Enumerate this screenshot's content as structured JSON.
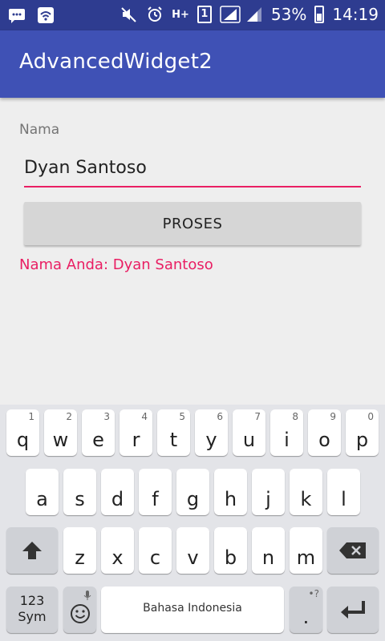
{
  "status_bar": {
    "battery_percent": "53%",
    "time": "14:19",
    "network_label": "H+",
    "sim_label": "1"
  },
  "app_bar": {
    "title": "AdvancedWidget2"
  },
  "form": {
    "label": "Nama",
    "input_value": "Dyan Santoso",
    "button_label": "PROSES",
    "result_text": "Nama Anda: Dyan Santoso"
  },
  "colors": {
    "status_bar": "#2e3c90",
    "app_bar": "#3f51b5",
    "accent": "#e91e63"
  },
  "keyboard": {
    "row1": [
      {
        "ch": "q",
        "hint": "1"
      },
      {
        "ch": "w",
        "hint": "2"
      },
      {
        "ch": "e",
        "hint": "3"
      },
      {
        "ch": "r",
        "hint": "4"
      },
      {
        "ch": "t",
        "hint": "5"
      },
      {
        "ch": "y",
        "hint": "6"
      },
      {
        "ch": "u",
        "hint": "7"
      },
      {
        "ch": "i",
        "hint": "8"
      },
      {
        "ch": "o",
        "hint": "9"
      },
      {
        "ch": "p",
        "hint": "0"
      }
    ],
    "row2": [
      "a",
      "s",
      "d",
      "f",
      "g",
      "h",
      "j",
      "k",
      "l"
    ],
    "row3": [
      "z",
      "x",
      "c",
      "v",
      "b",
      "n",
      "m"
    ],
    "sym_label_top": "123",
    "sym_label_bottom": "Sym",
    "space_label": "Bahasa Indonesia",
    "period_label": ".",
    "period_hint": "•?",
    "icons": {
      "shift": "shift-arrow-icon",
      "backspace": "backspace-icon",
      "enter": "enter-icon",
      "emoji": "emoji-icon",
      "mic": "mic-icon"
    }
  }
}
